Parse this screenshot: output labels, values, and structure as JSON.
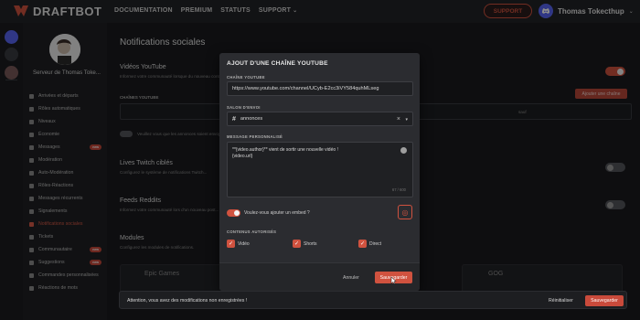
{
  "brand": {
    "name": "DRAFTBOT",
    "accent": "#d0523f"
  },
  "nav": {
    "items": [
      "DOCUMENTATION",
      "PREMIUM",
      "STATUTS"
    ],
    "support_menu": "SUPPORT",
    "support_button": "SUPPORT",
    "user_name": "Thomas Tokecthup"
  },
  "sidebar": {
    "server_name": "Serveur de Thomas Toke...",
    "items": [
      {
        "label": "Arrivées et départs"
      },
      {
        "label": "Rôles automatiques"
      },
      {
        "label": "Niveaux"
      },
      {
        "label": "Économie"
      },
      {
        "label": "Messages",
        "badge": "new"
      },
      {
        "label": "Modération"
      },
      {
        "label": "Auto-Modération"
      },
      {
        "label": "Rôles-Réactions"
      },
      {
        "label": "Messages récurrents"
      },
      {
        "label": "Signalements"
      },
      {
        "label": "Notifications sociales",
        "active": true
      },
      {
        "label": "Tickets"
      },
      {
        "label": "Communautaire",
        "badge": "new"
      },
      {
        "label": "Suggestions",
        "badge": "new"
      },
      {
        "label": "Commandes personnalisées"
      },
      {
        "label": "Réactions de mots"
      }
    ]
  },
  "main": {
    "page_title": "Notifications sociales",
    "youtube": {
      "title": "Vidéos YouTube",
      "desc": "Informez votre communauté lorsque du nouveau contenu est publié",
      "channels_label": "CHAÎNES YOUTUBE",
      "add_button": "Ajouter une chaîne",
      "input_hint": "sauf",
      "shorts_note": "Veuillez vous que les annonces soient envoyées..."
    },
    "twitch": {
      "title": "Lives Twitch ciblés",
      "desc": "Configurez le système de notifications Twitch..."
    },
    "reddit": {
      "title": "Feeds Reddits",
      "desc": "Informez votre communauté lors d'un nouveau post..."
    },
    "modules": {
      "title": "Modules",
      "desc": "Configurez les modules de notifications.",
      "cards": [
        "Epic Games",
        "GOG"
      ]
    }
  },
  "modal": {
    "title": "AJOUT D'UNE CHAÎNE YOUTUBE",
    "channel_label": "CHAÎNE YOUTUBE",
    "channel_value": "https://www.youtube.com/channel/UCyb-E2cc3iVY584quhMLseg",
    "salon_label": "SALON D'ENVOI",
    "salon_value": "annonces",
    "message_label": "MESSAGE PERSONNALISÉ",
    "message_line1": "**{video.author}** vient de sortir une nouvelle vidéo !",
    "message_line2": "{video.url}",
    "char_count": "67 / 600",
    "embed_label": "Voulez-vous ajouter un embed ?",
    "content_label": "CONTENUS AUTORISÉS",
    "content_options": [
      "Vidéo",
      "Shorts",
      "Direct"
    ],
    "cancel": "Annuler",
    "save": "Sauvegarder"
  },
  "warning": {
    "text": "Attention, vous avez des modifications non enregistrées !",
    "reset": "Réinitialiser",
    "save": "Sauvegarder"
  },
  "icons": [
    "discord-icon",
    "chevron-down-icon",
    "hash-icon",
    "emoji-icon",
    "embed-icon",
    "check-icon",
    "pointer-cursor-icon"
  ]
}
